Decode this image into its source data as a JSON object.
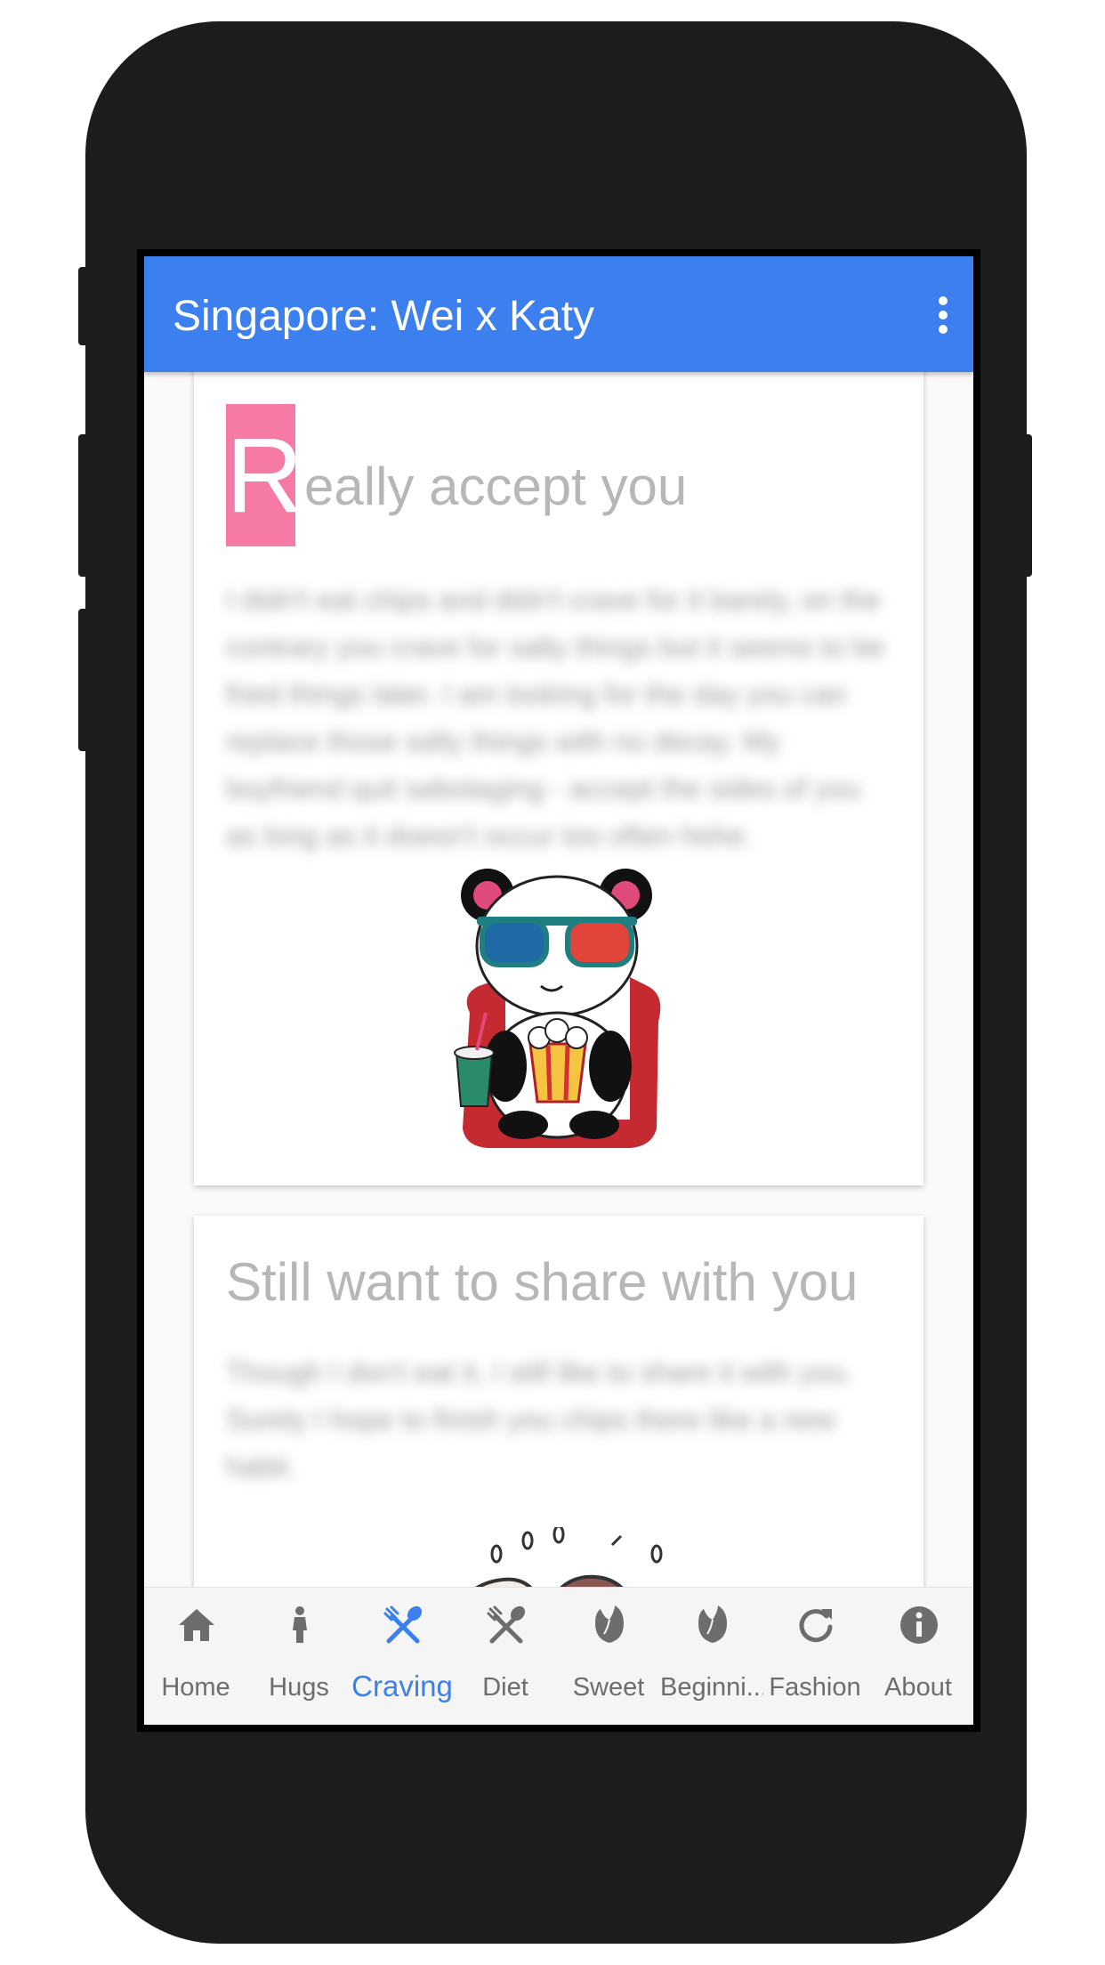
{
  "appbar": {
    "title": "Singapore: Wei x Katy",
    "menu_icon": "more-vert-icon"
  },
  "cards": [
    {
      "drop_cap": "R",
      "title_rest": "eally accept you",
      "body": "I didn't eat chips and didn't crave for it barely, on the contrary you crave for salty things but it seems to be fried things later. I am looking for the day you can replace those salty things with no decay. My boyfriend quit sabotaging - accept the sides of you as long as it doesn't occur too often hehe.",
      "illustration": "panda-cinema-illustration"
    },
    {
      "title": "Still want to share with you",
      "body": "Though I don't eat it, I still like to share it with you. Surely I hope to finish you chips there like a new habit.",
      "illustration": "sleepy-faces-sketch"
    }
  ],
  "bottom_nav": {
    "active_index": 2,
    "active_color": "#3b80ee",
    "items": [
      {
        "label": "Home",
        "icon": "home-icon"
      },
      {
        "label": "Hugs",
        "icon": "person-icon"
      },
      {
        "label": "Craving",
        "icon": "fork-spoon-icon"
      },
      {
        "label": "Diet",
        "icon": "fork-spoon-icon"
      },
      {
        "label": "Sweet",
        "icon": "tulip-icon"
      },
      {
        "label": "Beginni...",
        "icon": "tulip-icon"
      },
      {
        "label": "Fashion",
        "icon": "refresh-icon"
      },
      {
        "label": "About",
        "icon": "info-icon"
      }
    ]
  }
}
